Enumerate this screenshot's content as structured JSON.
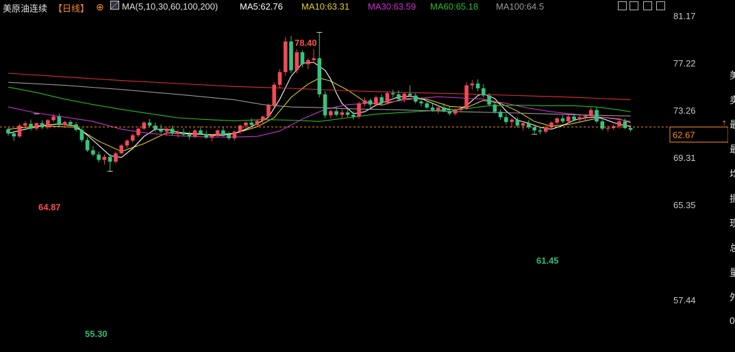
{
  "header": {
    "instrument": "美原油连续",
    "period": "【日线】",
    "ma_params": "MA(5,10,30,60,100,200)",
    "ma5": "MA5:62.76",
    "ma10": "MA10:63.31",
    "ma30": "MA30:63.59",
    "ma60": "MA60:65.18",
    "ma100": "MA100:64.5",
    "colors": {
      "instrument": "#e0e0e0",
      "period": "#ff8c1a",
      "ma5": "#ffffff",
      "ma10": "#e6d21c",
      "ma30": "#d030d0",
      "ma60": "#22c022",
      "ma100": "#9a9a9a"
    }
  },
  "toolbar_icons": [
    "zoom-in-icon",
    "zoom-out-icon",
    "step-back-icon",
    "step-forward-icon"
  ],
  "price_label": {
    "value": "62.67",
    "color": "#ff8c1a"
  },
  "right_panel_chars": [
    "美",
    "卖",
    "最",
    "最",
    "均",
    "振",
    "现",
    "总",
    "量",
    "外",
    "0"
  ],
  "chart_data": {
    "type": "candlestick",
    "yticks": [
      "81.17",
      "77.22",
      "73.26",
      "69.31",
      "65.35",
      "57.44"
    ],
    "ylim": [
      55.0,
      81.17
    ],
    "last_price": 62.67,
    "annotations": [
      {
        "label": "78.40",
        "kind": "high",
        "color": "#ff4d4d"
      },
      {
        "label": "64.87",
        "kind": "high",
        "color": "#ff4d4d"
      },
      {
        "label": "55.30",
        "kind": "low",
        "color": "#2fbf71"
      },
      {
        "label": "61.45",
        "kind": "low",
        "color": "#2fbf71"
      }
    ],
    "ohlc": [
      [
        62.3,
        62.6,
        61.2,
        61.6
      ],
      [
        61.6,
        62.0,
        60.4,
        61.1
      ],
      [
        61.1,
        63.2,
        60.9,
        62.9
      ],
      [
        62.9,
        63.6,
        62.5,
        63.3
      ],
      [
        63.2,
        63.9,
        62.1,
        62.4
      ],
      [
        62.4,
        63.4,
        62.1,
        63.3
      ],
      [
        63.3,
        63.8,
        62.3,
        62.6
      ],
      [
        62.6,
        64.0,
        62.3,
        63.8
      ],
      [
        63.8,
        64.8,
        63.5,
        64.4
      ],
      [
        64.4,
        64.9,
        62.7,
        63.0
      ],
      [
        63.0,
        63.7,
        62.5,
        63.5
      ],
      [
        63.5,
        63.8,
        62.8,
        63.1
      ],
      [
        63.1,
        63.5,
        61.9,
        62.2
      ],
      [
        62.2,
        62.6,
        60.1,
        60.5
      ],
      [
        60.5,
        61.0,
        58.5,
        58.8
      ],
      [
        58.8,
        59.5,
        57.8,
        58.1
      ],
      [
        58.1,
        58.6,
        56.8,
        57.2
      ],
      [
        57.2,
        58.1,
        56.4,
        57.7
      ],
      [
        57.7,
        58.2,
        55.3,
        56.9
      ],
      [
        56.9,
        58.6,
        56.6,
        58.3
      ],
      [
        58.3,
        59.8,
        58.1,
        59.6
      ],
      [
        59.6,
        60.6,
        59.2,
        60.4
      ],
      [
        60.4,
        61.6,
        60.1,
        61.3
      ],
      [
        61.3,
        62.6,
        61.0,
        62.4
      ],
      [
        62.4,
        63.6,
        62.2,
        63.4
      ],
      [
        63.4,
        64.0,
        62.7,
        62.9
      ],
      [
        62.9,
        63.4,
        61.9,
        62.3
      ],
      [
        62.3,
        63.1,
        61.6,
        61.9
      ],
      [
        61.9,
        62.6,
        61.2,
        62.4
      ],
      [
        62.4,
        62.9,
        61.3,
        61.6
      ],
      [
        61.6,
        62.2,
        60.9,
        61.8
      ],
      [
        61.8,
        62.4,
        61.1,
        61.4
      ],
      [
        61.4,
        61.9,
        60.6,
        61.1
      ],
      [
        61.1,
        62.3,
        60.8,
        62.1
      ],
      [
        62.1,
        62.8,
        61.3,
        61.5
      ],
      [
        61.5,
        62.1,
        60.7,
        60.9
      ],
      [
        60.9,
        61.5,
        60.3,
        61.3
      ],
      [
        61.3,
        62.3,
        61.0,
        62.1
      ],
      [
        62.1,
        62.6,
        61.1,
        61.4
      ],
      [
        61.4,
        61.9,
        60.5,
        60.8
      ],
      [
        60.8,
        62.1,
        60.4,
        61.9
      ],
      [
        61.9,
        63.1,
        61.5,
        62.9
      ],
      [
        62.9,
        63.6,
        62.3,
        63.4
      ],
      [
        63.4,
        64.1,
        62.8,
        63.0
      ],
      [
        63.0,
        63.9,
        62.6,
        63.7
      ],
      [
        63.7,
        64.6,
        63.3,
        64.4
      ],
      [
        64.4,
        66.6,
        64.1,
        66.3
      ],
      [
        66.3,
        70.1,
        65.9,
        69.7
      ],
      [
        69.7,
        72.3,
        69.1,
        71.8
      ],
      [
        71.8,
        77.6,
        71.2,
        76.9
      ],
      [
        76.9,
        77.8,
        71.6,
        72.1
      ],
      [
        72.1,
        75.6,
        71.6,
        75.1
      ],
      [
        75.1,
        75.4,
        72.6,
        73.1
      ],
      [
        73.1,
        74.1,
        72.3,
        73.8
      ],
      [
        73.8,
        75.6,
        73.3,
        74.1
      ],
      [
        74.1,
        78.4,
        67.6,
        68.1
      ],
      [
        68.1,
        68.6,
        64.1,
        64.6
      ],
      [
        64.6,
        65.6,
        64.1,
        65.3
      ],
      [
        65.3,
        66.1,
        64.4,
        64.7
      ],
      [
        64.7,
        65.6,
        64.2,
        65.1
      ],
      [
        65.1,
        65.9,
        64.3,
        64.7
      ],
      [
        64.7,
        65.3,
        63.9,
        64.4
      ],
      [
        64.4,
        66.9,
        64.1,
        66.6
      ],
      [
        66.6,
        67.6,
        66.1,
        67.1
      ],
      [
        67.1,
        67.4,
        65.9,
        66.4
      ],
      [
        66.4,
        67.9,
        66.1,
        67.6
      ],
      [
        67.6,
        68.1,
        66.3,
        66.7
      ],
      [
        66.7,
        68.6,
        66.4,
        68.3
      ],
      [
        68.3,
        68.9,
        67.6,
        68.1
      ],
      [
        68.1,
        68.8,
        66.9,
        67.3
      ],
      [
        67.3,
        68.4,
        66.8,
        68.2
      ],
      [
        68.2,
        69.6,
        67.7,
        67.9
      ],
      [
        67.9,
        68.3,
        66.6,
        66.9
      ],
      [
        66.9,
        67.6,
        66.1,
        66.6
      ],
      [
        66.6,
        67.1,
        65.6,
        65.9
      ],
      [
        65.9,
        66.5,
        65.2,
        65.5
      ],
      [
        65.5,
        66.3,
        64.9,
        65.9
      ],
      [
        65.9,
        66.6,
        65.1,
        65.3
      ],
      [
        65.3,
        66.1,
        64.6,
        64.9
      ],
      [
        64.9,
        65.7,
        64.6,
        65.5
      ],
      [
        65.5,
        66.2,
        65.1,
        65.8
      ],
      [
        65.8,
        70.1,
        65.5,
        69.6
      ],
      [
        69.6,
        70.5,
        68.9,
        69.9
      ],
      [
        69.9,
        70.6,
        68.6,
        69.1
      ],
      [
        69.1,
        69.8,
        67.6,
        67.9
      ],
      [
        67.9,
        68.3,
        66.1,
        66.4
      ],
      [
        66.4,
        66.9,
        64.9,
        65.2
      ],
      [
        65.2,
        65.6,
        63.9,
        64.3
      ],
      [
        64.3,
        64.8,
        63.1,
        63.5
      ],
      [
        63.5,
        64.1,
        62.6,
        63.9
      ],
      [
        63.9,
        64.3,
        62.6,
        62.9
      ],
      [
        62.9,
        63.6,
        62.1,
        63.3
      ],
      [
        63.3,
        63.9,
        62.3,
        62.6
      ],
      [
        62.6,
        63.1,
        61.6,
        62.1
      ],
      [
        62.1,
        62.8,
        61.45,
        61.9
      ],
      [
        61.9,
        62.9,
        61.6,
        62.6
      ],
      [
        62.6,
        63.6,
        62.3,
        63.4
      ],
      [
        63.4,
        64.3,
        63.1,
        64.1
      ],
      [
        64.1,
        64.6,
        63.3,
        63.6
      ],
      [
        63.6,
        64.8,
        63.3,
        64.4
      ],
      [
        64.4,
        64.9,
        63.6,
        63.9
      ],
      [
        63.9,
        64.6,
        63.5,
        64.3
      ],
      [
        64.3,
        64.8,
        63.8,
        64.5
      ],
      [
        64.5,
        65.9,
        64.1,
        65.5
      ],
      [
        65.5,
        65.9,
        63.3,
        63.6
      ],
      [
        63.6,
        64.1,
        62.1,
        62.4
      ],
      [
        62.4,
        62.9,
        61.9,
        62.5
      ],
      [
        62.5,
        63.1,
        62.2,
        62.8
      ],
      [
        62.8,
        64.0,
        62.4,
        63.6
      ],
      [
        63.6,
        64.1,
        62.3,
        62.5
      ],
      [
        62.5,
        63.0,
        61.9,
        62.2
      ]
    ],
    "ma_lines": [
      {
        "name": "MA10",
        "color": "#e6d21c",
        "points": [
          [
            0,
            62.3
          ],
          [
            6,
            62.9
          ],
          [
            12,
            62.6
          ],
          [
            16,
            60.3
          ],
          [
            20,
            58.6
          ],
          [
            24,
            59.9
          ],
          [
            28,
            61.7
          ],
          [
            32,
            61.5
          ],
          [
            36,
            61.4
          ],
          [
            40,
            61.6
          ],
          [
            44,
            62.7
          ],
          [
            47,
            64.2
          ],
          [
            50,
            67.6
          ],
          [
            53,
            69.8
          ],
          [
            55,
            70.8
          ],
          [
            57,
            70.3
          ],
          [
            60,
            68.8
          ],
          [
            63,
            66.9
          ],
          [
            66,
            66.3
          ],
          [
            70,
            67.4
          ],
          [
            74,
            67.3
          ],
          [
            78,
            66.1
          ],
          [
            81,
            65.9
          ],
          [
            84,
            67.1
          ],
          [
            87,
            66.6
          ],
          [
            90,
            65.3
          ],
          [
            93,
            63.6
          ],
          [
            96,
            62.8
          ],
          [
            99,
            63.1
          ],
          [
            102,
            63.7
          ],
          [
            105,
            64.3
          ],
          [
            108,
            64.0
          ],
          [
            110,
            63.4
          ]
        ]
      },
      {
        "name": "MA5",
        "color": "#ffffff",
        "points": [
          [
            0,
            61.6
          ],
          [
            3,
            62.3
          ],
          [
            6,
            62.9
          ],
          [
            9,
            63.2
          ],
          [
            12,
            62.8
          ],
          [
            14,
            61.3
          ],
          [
            16,
            59.6
          ],
          [
            18,
            57.9
          ],
          [
            20,
            57.6
          ],
          [
            22,
            59.1
          ],
          [
            24,
            61.1
          ],
          [
            26,
            62.3
          ],
          [
            28,
            62.3
          ],
          [
            30,
            61.8
          ],
          [
            32,
            61.6
          ],
          [
            34,
            61.5
          ],
          [
            36,
            61.3
          ],
          [
            38,
            61.3
          ],
          [
            40,
            61.6
          ],
          [
            42,
            62.3
          ],
          [
            44,
            63.2
          ],
          [
            46,
            64.3
          ],
          [
            48,
            67.3
          ],
          [
            50,
            71.1
          ],
          [
            52,
            73.3
          ],
          [
            54,
            73.4
          ],
          [
            56,
            72.1
          ],
          [
            57,
            70.6
          ],
          [
            58,
            68.3
          ],
          [
            59,
            66.6
          ],
          [
            61,
            64.9
          ],
          [
            63,
            65.2
          ],
          [
            65,
            66.3
          ],
          [
            67,
            67.0
          ],
          [
            69,
            67.7
          ],
          [
            71,
            67.8
          ],
          [
            73,
            67.4
          ],
          [
            75,
            66.6
          ],
          [
            77,
            65.8
          ],
          [
            79,
            65.4
          ],
          [
            81,
            66.2
          ],
          [
            83,
            67.9
          ],
          [
            84,
            68.2
          ],
          [
            86,
            67.4
          ],
          [
            88,
            65.3
          ],
          [
            90,
            63.8
          ],
          [
            92,
            63.3
          ],
          [
            94,
            62.6
          ],
          [
            96,
            62.3
          ],
          [
            98,
            62.9
          ],
          [
            100,
            63.8
          ],
          [
            102,
            64.2
          ],
          [
            104,
            64.3
          ],
          [
            105,
            64.1
          ],
          [
            107,
            63.4
          ],
          [
            109,
            62.9
          ],
          [
            110,
            62.8
          ]
        ]
      },
      {
        "name": "MA30",
        "color": "#d030d0",
        "points": [
          [
            0,
            66.0
          ],
          [
            5,
            65.0
          ],
          [
            10,
            64.3
          ],
          [
            15,
            63.6
          ],
          [
            20,
            62.3
          ],
          [
            25,
            61.6
          ],
          [
            30,
            61.2
          ],
          [
            35,
            61.0
          ],
          [
            40,
            61.0
          ],
          [
            44,
            61.1
          ],
          [
            48,
            62.0
          ],
          [
            52,
            64.0
          ],
          [
            56,
            65.6
          ],
          [
            60,
            66.4
          ],
          [
            64,
            66.6
          ],
          [
            68,
            66.9
          ],
          [
            72,
            67.4
          ],
          [
            76,
            67.7
          ],
          [
            80,
            67.5
          ],
          [
            84,
            67.3
          ],
          [
            88,
            66.6
          ],
          [
            92,
            65.8
          ],
          [
            96,
            65.2
          ],
          [
            100,
            64.8
          ],
          [
            104,
            64.4
          ],
          [
            108,
            63.9
          ],
          [
            110,
            63.6
          ]
        ]
      },
      {
        "name": "MA60",
        "color": "#22c022",
        "points": [
          [
            0,
            69.3
          ],
          [
            5,
            68.4
          ],
          [
            10,
            67.3
          ],
          [
            15,
            66.4
          ],
          [
            20,
            65.6
          ],
          [
            25,
            64.9
          ],
          [
            30,
            64.2
          ],
          [
            35,
            63.9
          ],
          [
            40,
            63.7
          ],
          [
            45,
            63.9
          ],
          [
            50,
            63.8
          ],
          [
            55,
            63.6
          ],
          [
            60,
            64.2
          ],
          [
            65,
            64.8
          ],
          [
            70,
            65.1
          ],
          [
            75,
            65.4
          ],
          [
            80,
            65.6
          ],
          [
            85,
            66.2
          ],
          [
            90,
            66.3
          ],
          [
            95,
            66.2
          ],
          [
            100,
            66.2
          ],
          [
            104,
            66.0
          ],
          [
            108,
            65.5
          ],
          [
            110,
            65.2
          ]
        ]
      },
      {
        "name": "MA100",
        "color": "#9a9a9a",
        "points": [
          [
            0,
            70.1
          ],
          [
            10,
            69.6
          ],
          [
            20,
            68.9
          ],
          [
            30,
            68.1
          ],
          [
            40,
            67.2
          ],
          [
            45,
            66.4
          ],
          [
            50,
            66.0
          ],
          [
            55,
            65.9
          ],
          [
            60,
            65.7
          ],
          [
            70,
            65.5
          ],
          [
            80,
            65.2
          ],
          [
            90,
            65.0
          ],
          [
            100,
            64.7
          ],
          [
            110,
            64.5
          ]
        ]
      },
      {
        "name": "MA200",
        "color": "#e03030",
        "points": [
          [
            0,
            71.6
          ],
          [
            10,
            71.0
          ],
          [
            20,
            70.4
          ],
          [
            30,
            69.9
          ],
          [
            40,
            69.4
          ],
          [
            50,
            69.1
          ],
          [
            60,
            68.7
          ],
          [
            70,
            68.4
          ],
          [
            80,
            68.2
          ],
          [
            90,
            67.9
          ],
          [
            100,
            67.6
          ],
          [
            110,
            67.2
          ]
        ]
      }
    ]
  }
}
